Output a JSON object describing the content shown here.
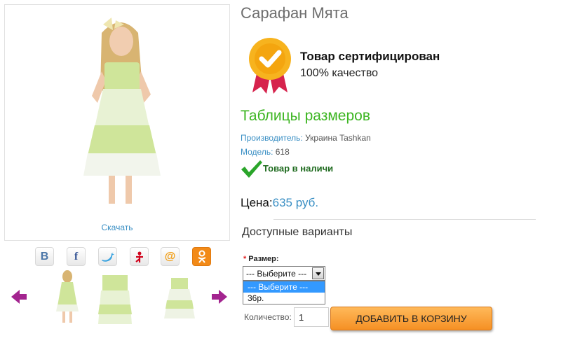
{
  "gallery": {
    "download_label": "Скачать"
  },
  "share": {
    "vk_glyph": "В",
    "facebook_glyph": "f",
    "at_glyph": "@"
  },
  "product": {
    "title": "Сарафан Мята",
    "certified_title": "Товар сертифицирован",
    "certified_subtitle": "100% качество",
    "size_table_link": "Таблицы размеров",
    "manufacturer_label": "Производитель:",
    "manufacturer_value": " Украина Tashkan",
    "model_label": "Модель:",
    "model_value": " 618",
    "stock_status": "Товар в наличи",
    "price_label": "Цена:",
    "price_value": "635 руб."
  },
  "options": {
    "heading": "Доступные варианты",
    "size_required_mark": "*",
    "size_label": "Размер:",
    "size_selected": "--- Выберите ---",
    "size_options": [
      "--- Выберите ---",
      "36р."
    ]
  },
  "purchase": {
    "quantity_label": "Количество:",
    "quantity_value": "1",
    "add_to_cart_label": "ДОБАВИТЬ В КОРЗИНУ"
  },
  "colors": {
    "link_blue": "#3a8fc4",
    "green_heading": "#3cb521",
    "cart_orange": "#f59024",
    "badge_gold": "#f7b31e",
    "ribbon_red": "#d6234d",
    "arrow_purple": "#a3248f"
  }
}
